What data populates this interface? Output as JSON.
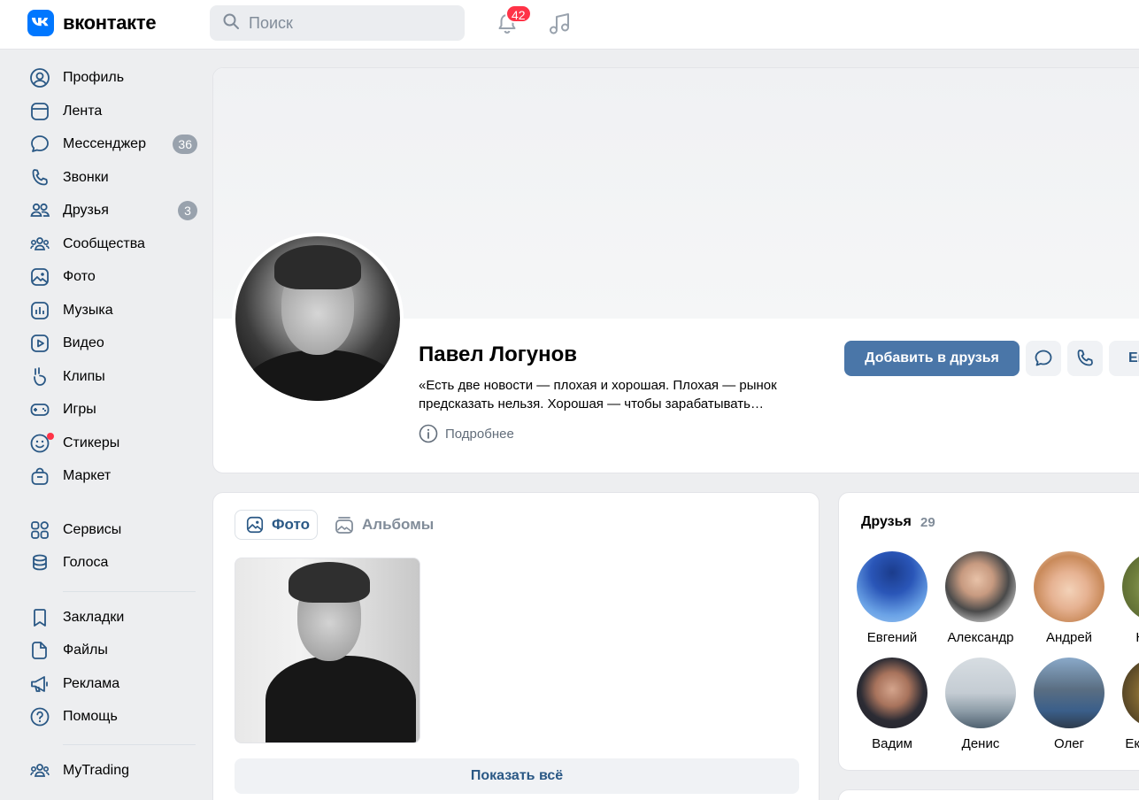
{
  "header": {
    "logo_text": "вконтакте",
    "search_placeholder": "Поиск",
    "notifications_count": "42"
  },
  "sidebar": {
    "items": [
      {
        "label": "Профиль",
        "icon": "user-circle-icon"
      },
      {
        "label": "Лента",
        "icon": "feed-icon"
      },
      {
        "label": "Мессенджер",
        "icon": "message-icon",
        "count": "36"
      },
      {
        "label": "Звонки",
        "icon": "phone-icon"
      },
      {
        "label": "Друзья",
        "icon": "friends-icon",
        "count": "3"
      },
      {
        "label": "Сообщества",
        "icon": "communities-icon"
      },
      {
        "label": "Фото",
        "icon": "photo-icon"
      },
      {
        "label": "Музыка",
        "icon": "music-icon"
      },
      {
        "label": "Видео",
        "icon": "video-icon"
      },
      {
        "label": "Клипы",
        "icon": "clips-icon"
      },
      {
        "label": "Игры",
        "icon": "gamepad-icon"
      },
      {
        "label": "Стикеры",
        "icon": "smile-icon"
      },
      {
        "label": "Маркет",
        "icon": "market-icon"
      },
      {
        "label": "Сервисы",
        "icon": "services-icon"
      },
      {
        "label": "Голоса",
        "icon": "coins-icon"
      },
      {
        "label": "Закладки",
        "icon": "bookmark-icon"
      },
      {
        "label": "Файлы",
        "icon": "file-icon"
      },
      {
        "label": "Реклама",
        "icon": "megaphone-icon"
      },
      {
        "label": "Помощь",
        "icon": "help-icon"
      },
      {
        "label": "MyTrading",
        "icon": "group-icon"
      }
    ]
  },
  "profile": {
    "name": "Павел Логунов",
    "status": "«Есть две новости — плохая и хорошая. Плохая — рынок предсказать нельзя. Хорошая — чтобы зарабатывать…",
    "more_label": "Подробнее",
    "add_friend_label": "Добавить в друзья",
    "more_button_label": "Ещё"
  },
  "photos": {
    "tab_photos": "Фото",
    "tab_albums": "Альбомы",
    "show_all": "Показать всё"
  },
  "friends": {
    "title": "Друзья",
    "count": "29",
    "list": [
      {
        "name": "Евгений"
      },
      {
        "name": "Александр"
      },
      {
        "name": "Андрей"
      },
      {
        "name": "Никита"
      },
      {
        "name": "Вадим"
      },
      {
        "name": "Денис"
      },
      {
        "name": "Олег"
      },
      {
        "name": "Екатерина"
      }
    ]
  },
  "colors": {
    "accent": "#4a76a8",
    "link": "#2a5885",
    "badge": "#ff3347",
    "logo": "#0077ff"
  }
}
